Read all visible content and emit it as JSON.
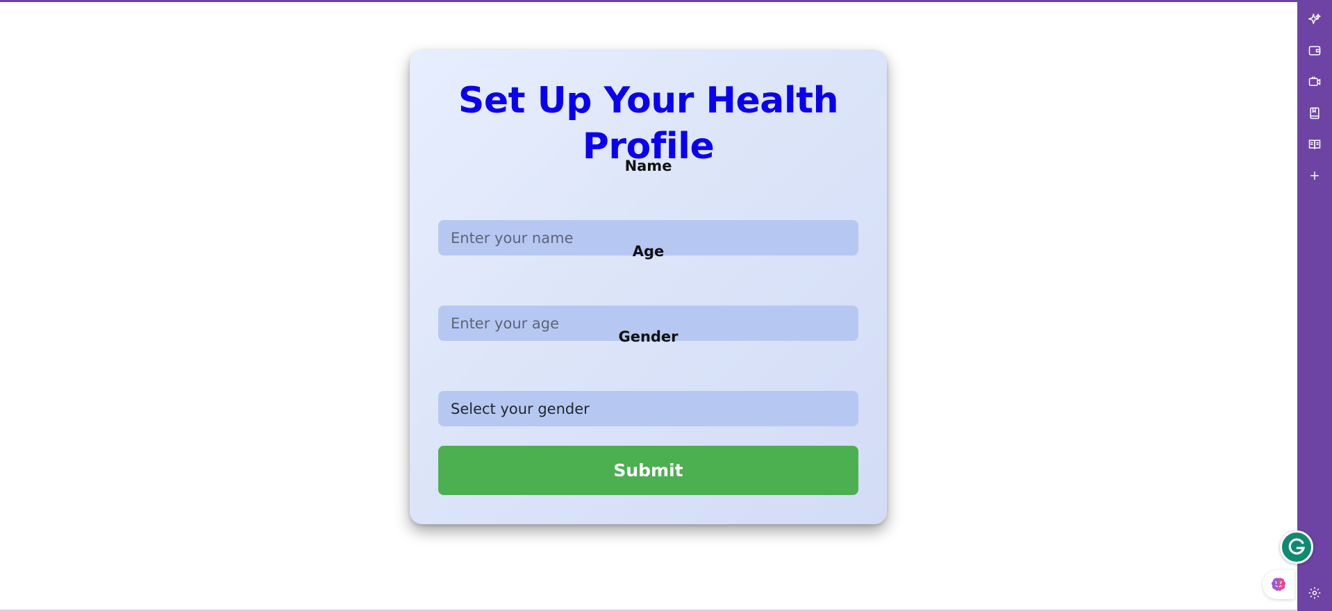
{
  "form": {
    "title": "Set Up Your Health Profile",
    "name_label": "Name",
    "name_placeholder": "Enter your name",
    "age_label": "Age",
    "age_placeholder": "Enter your age",
    "gender_label": "Gender",
    "gender_selected": "Select your gender",
    "submit_label": "Submit"
  },
  "colors": {
    "title": "#0a00f0",
    "input_bg": "#b6c8f2",
    "submit_bg": "#4caf50",
    "sidebar_bg": "#6d44a4",
    "card_bg": "#dfe7fb"
  },
  "sidebar": {
    "icons": [
      "sparkle-icon",
      "wallet-icon",
      "video-icon",
      "bookmark-icon",
      "book-icon",
      "plus-icon",
      "gear-icon"
    ]
  },
  "widgets": {
    "grammarly_icon": "grammarly-icon",
    "brain_icon": "brain-icon"
  }
}
